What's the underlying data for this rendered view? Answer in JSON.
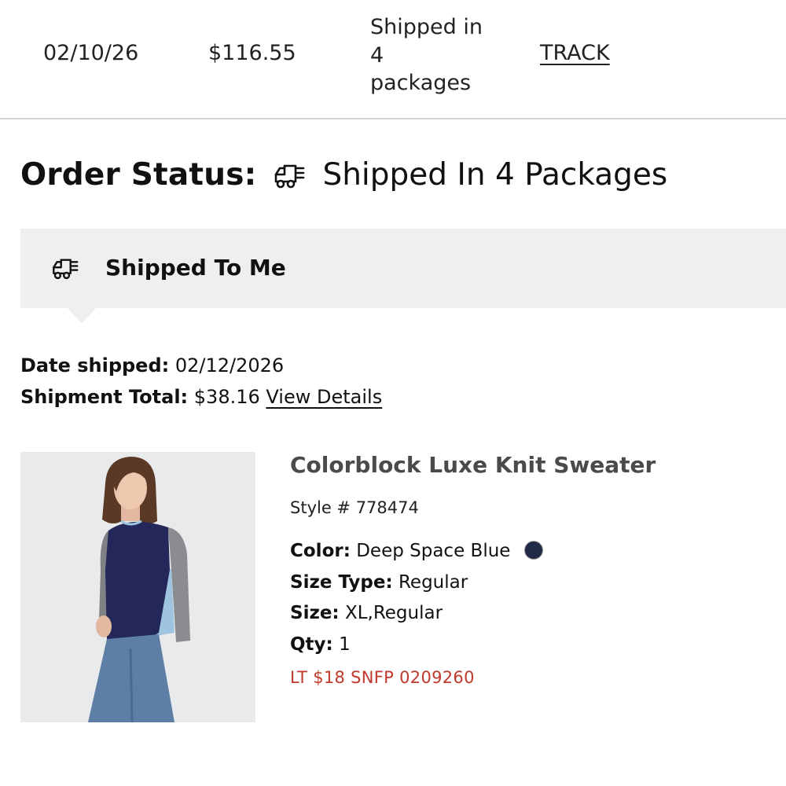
{
  "order_row": {
    "date": "02/10/26",
    "total": "$116.55",
    "status_lines": [
      "Shipped in",
      "4",
      "packages"
    ],
    "track_label": "TRACK"
  },
  "order_status": {
    "label": "Order Status:",
    "icon": "delivery-truck-icon",
    "value": "Shipped In 4 Packages"
  },
  "shipment": {
    "icon": "delivery-truck-icon",
    "title": "Shipped To Me",
    "date_label": "Date shipped:",
    "date_value": "02/12/2026",
    "total_label": "Shipment Total:",
    "total_value": "$38.16",
    "details_link": "View Details"
  },
  "product": {
    "name": "Colorblock Luxe Knit Sweater",
    "style": "Style # 778474",
    "color_label": "Color:",
    "color_value": "Deep Space Blue",
    "color_swatch": "#1f2a44",
    "size_type_label": "Size Type:",
    "size_type_value": "Regular",
    "size_label": "Size:",
    "size_value": "XL,Regular",
    "qty_label": "Qty:",
    "qty_value": "1",
    "promo": "LT $18 SNFP 0209260",
    "promo_color": "#c0392b"
  }
}
